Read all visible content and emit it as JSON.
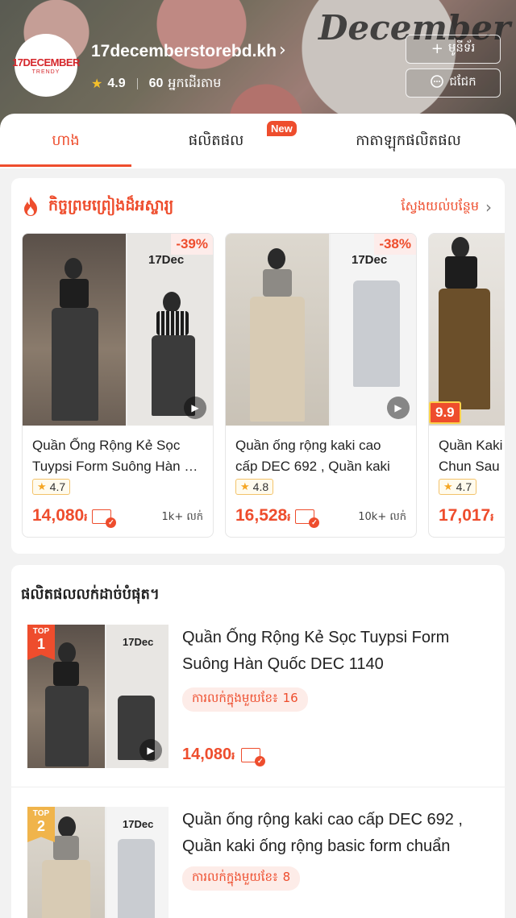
{
  "header": {
    "banner_text": "December",
    "logo_main": "17DECEMBER",
    "logo_sub": "TRENDY",
    "shop_name": "17decemberstorebd.kh",
    "rating": "4.9",
    "followers": "60",
    "followers_label": "អ្នកដើរតាម",
    "follow_button": "មូនីទ័រ",
    "chat_button": "ជជែក"
  },
  "tabs": [
    {
      "label": "ហាង",
      "active": true
    },
    {
      "label": "ផលិតផល",
      "badge": "New"
    },
    {
      "label": "កាតាឡុកផលិតផល"
    }
  ],
  "flash": {
    "title": "កិច្ចព្រមព្រៀងដ៏អស្ចារ្យ",
    "see_more": "ស្វែងយល់បន្ថែម",
    "cards": [
      {
        "name_line1": "Quần Ống Rộng Kẻ Sọc",
        "name_line2": "Tuypsi Form Suông Hàn Quốc",
        "discount": "-39%",
        "brand": "17Dec",
        "rating": "4.7",
        "price": "14,080",
        "currency": "៛",
        "sold": "1k+ លក់"
      },
      {
        "name_line1": "Quần ống rộng kaki cao",
        "name_line2": "cấp DEC 692 , Quần kaki",
        "discount": "-38%",
        "brand": "17Dec",
        "rating": "4.8",
        "price": "16,528",
        "currency": "៛",
        "sold": "10k+ លក់"
      },
      {
        "name_line1": "Quần Kaki",
        "name_line2": "Chun Sau",
        "badge": "9.9",
        "rating": "4.7",
        "price": "17,017",
        "currency": "៛"
      }
    ]
  },
  "top_selling": {
    "title": "ផលិតផលលក់ដាច់បំផុត។",
    "items": [
      {
        "rank_label": "TOP",
        "rank": "1",
        "brand": "17Dec",
        "name_line1": "Quần Ống Rộng Kẻ Sọc Tuypsi Form",
        "name_line2": "Suông Hàn Quốc DEC 1140",
        "sold_label": "ការលក់ក្នុងមួយខែ៖",
        "sold_count": "16",
        "price": "14,080",
        "currency": "៛"
      },
      {
        "rank_label": "TOP",
        "rank": "2",
        "brand": "17Dec",
        "name_line1": "Quần ống rộng kaki cao cấp DEC 692 ,",
        "name_line2": "Quần kaki ống rộng basic form chuẩn",
        "sold_label": "ការលក់ក្នុងមួយខែ៖",
        "sold_count": "8"
      }
    ]
  },
  "colors": {
    "accent": "#ee4d2d"
  }
}
